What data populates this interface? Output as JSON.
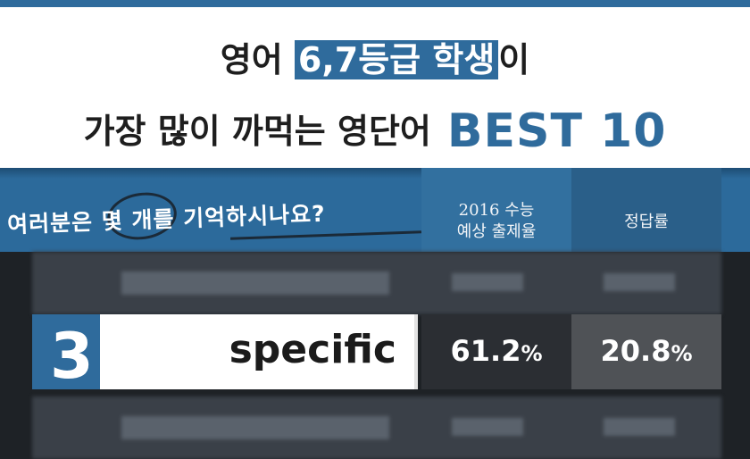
{
  "title": {
    "line1_before": "영어 ",
    "line1_highlight": "6,7등급 학생",
    "line1_after": "이",
    "line2_text": "가장 많이 까먹는 영단어",
    "line2_best": "BEST 10"
  },
  "band": {
    "question": "여러분은 몇 개를 기억하시나요?",
    "col1_header_line1": "2016 수능",
    "col1_header_line2": "예상 출제율",
    "col2_header": "정답률"
  },
  "row": {
    "rank": "3",
    "word": "specific",
    "predicted_rate": "61.2",
    "predicted_unit": "%",
    "accuracy_rate": "20.8",
    "accuracy_unit": "%"
  },
  "colors": {
    "accent_blue": "#2f6b9c",
    "dark_cell": "#2b2e33",
    "gray_cell": "#4f5256"
  }
}
